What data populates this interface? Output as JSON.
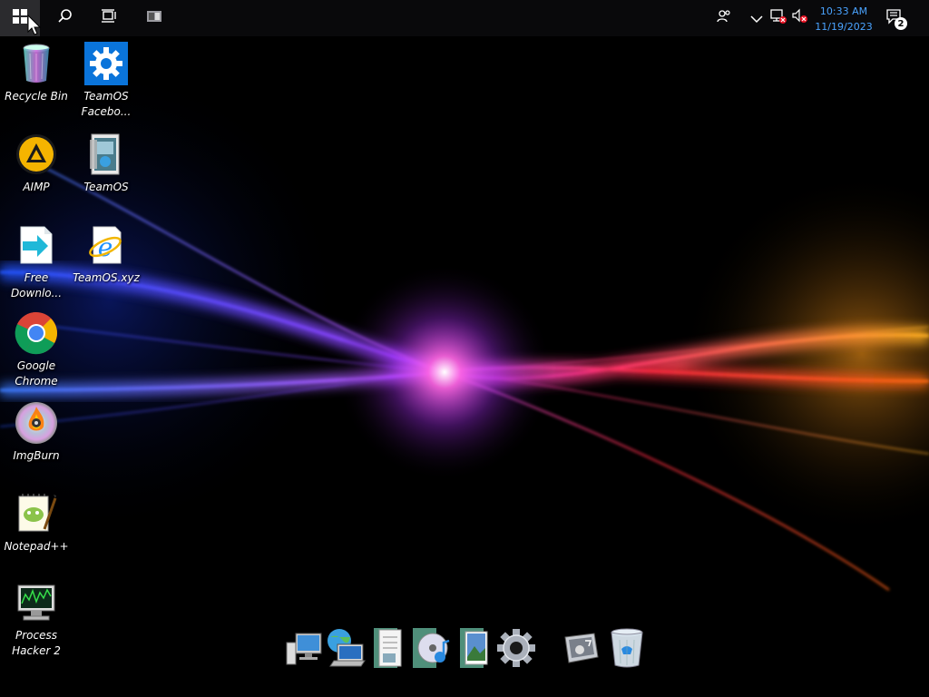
{
  "taskbar": {
    "start_icon": "windows-start-icon",
    "search_icon": "search-icon",
    "taskview_icon": "task-view-icon",
    "pinned_app_icon": "app-icon",
    "tray": {
      "people_icon": "people-icon",
      "overflow_icon": "chevron-down-icon",
      "network_icon": "network-disconnected-icon",
      "volume_icon": "volume-muted-icon"
    },
    "clock": {
      "time": "10:33 AM",
      "date": "11/19/2023"
    },
    "notifications": {
      "icon": "action-center-icon",
      "count": "2"
    }
  },
  "desktop": {
    "icons": [
      {
        "id": "recycle-bin",
        "label_line1": "Recycle Bin",
        "label_line2": ""
      },
      {
        "id": "teamos-facebook",
        "label_line1": "TeamOS",
        "label_line2": "Facebo..."
      },
      {
        "id": "aimp",
        "label_line1": "AIMP",
        "label_line2": ""
      },
      {
        "id": "teamos",
        "label_line1": "TeamOS",
        "label_line2": ""
      },
      {
        "id": "free-download-manager",
        "label_line1": "Free",
        "label_line2": "Downlo..."
      },
      {
        "id": "teamos-xyz",
        "label_line1": "TeamOS.xyz",
        "label_line2": ""
      },
      {
        "id": "google-chrome",
        "label_line1": "Google",
        "label_line2": "Chrome"
      },
      {
        "id": "imgburn",
        "label_line1": "ImgBurn",
        "label_line2": ""
      },
      {
        "id": "notepad-plus-plus",
        "label_line1": "Notepad++",
        "label_line2": ""
      },
      {
        "id": "process-hacker",
        "label_line1": "Process",
        "label_line2": "Hacker 2"
      }
    ]
  },
  "dock": {
    "items": [
      "computer-icon",
      "network-icon",
      "documents-icon",
      "music-icon",
      "pictures-icon",
      "settings-gear-icon",
      "control-panel-icon",
      "recycle-bin-icon"
    ]
  },
  "colors": {
    "clock": "#4aa3ff",
    "taskbar": "#0a0a0c",
    "wallpaper_blue": "#2f6bff",
    "wallpaper_pink": "#ff3ad0",
    "wallpaper_orange": "#ff9a1a"
  }
}
